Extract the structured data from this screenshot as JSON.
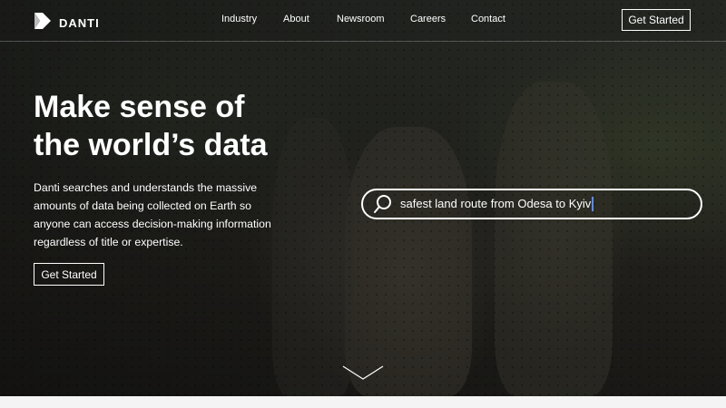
{
  "brand": {
    "name": "DANTI",
    "logo_icon": "danti-logo-icon"
  },
  "nav": {
    "items": [
      {
        "label": "Industry"
      },
      {
        "label": "About"
      },
      {
        "label": "Newsroom"
      },
      {
        "label": "Careers"
      },
      {
        "label": "Contact"
      }
    ],
    "cta_label": "Get Started"
  },
  "hero": {
    "headline_line1": "Make sense of",
    "headline_line2": "the world’s data",
    "description": "Danti searches and understands the massive amounts of data being collected on Earth so anyone can access decision-making information regardless of title or expertise.",
    "cta_label": "Get Started",
    "background_image": "soldiers walking on a dirt road"
  },
  "search": {
    "value": "safest land route from Odesa to Kyiv",
    "icon": "search-icon"
  },
  "scroll_indicator_icon": "chevron-down-icon",
  "colors": {
    "text": "#ffffff",
    "caret": "#5b8cff",
    "footer_strip": "#f4f4f4"
  }
}
